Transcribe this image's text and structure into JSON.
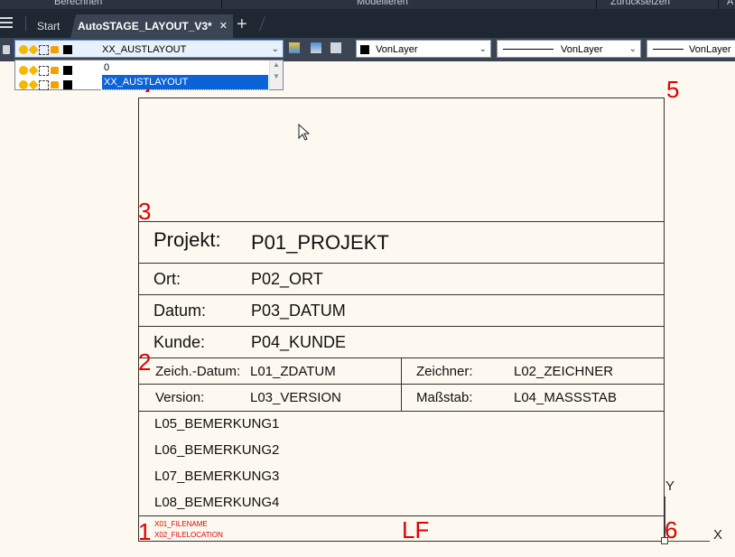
{
  "ribbon": {
    "left": "Berechnen",
    "middle": "Modellieren",
    "right": "Zurücksetzen",
    "far_right": "A"
  },
  "tabs": {
    "start": "Start",
    "active": "AutoSTAGE_LAYOUT_V3*",
    "close": "✕",
    "new": "+"
  },
  "toolbar": {
    "layer_value": "XX_AUSTLAYOUT",
    "color_value": "VonLayer",
    "linetype_value": "VonLayer",
    "lineweight_value": "VonLayer"
  },
  "layer_dropdown": {
    "items": [
      "0",
      "XX_AUSTLAYOUT"
    ],
    "selected": "XX_AUSTLAYOUT"
  },
  "title_block": {
    "rows": [
      {
        "label": "Projekt:",
        "value": "P01_PROJEKT"
      },
      {
        "label": "Ort:",
        "value": "P02_ORT"
      },
      {
        "label": "Datum:",
        "value": "P03_DATUM"
      },
      {
        "label": "Kunde:",
        "value": "P04_KUNDE"
      }
    ],
    "small": [
      {
        "label": "Zeich.-Datum:",
        "value": "L01_ZDATUM",
        "label2": "Zeichner:",
        "value2": "L02_ZEICHNER"
      },
      {
        "label": "Version:",
        "value": "L03_VERSION",
        "label2": "Maßstab:",
        "value2": "L04_MASSSTAB"
      }
    ],
    "remarks": [
      "L05_BEMERKUNG1",
      "L06_BEMERKUNG2",
      "L07_BEMERKUNG3",
      "L08_BEMERKUNG4"
    ],
    "file_lines": [
      "X01_FILENAME",
      "X02_FILELOCATION"
    ]
  },
  "markers": {
    "m1": "1",
    "m2": "2",
    "m3": "3",
    "m4": "4",
    "m5": "5",
    "m6": "6",
    "lf": "LF"
  },
  "ucs": {
    "y": "Y",
    "x": "X"
  },
  "colors": {
    "marker": "#e00000",
    "selection": "#0a64d8",
    "canvas": "#fdf9f0"
  }
}
